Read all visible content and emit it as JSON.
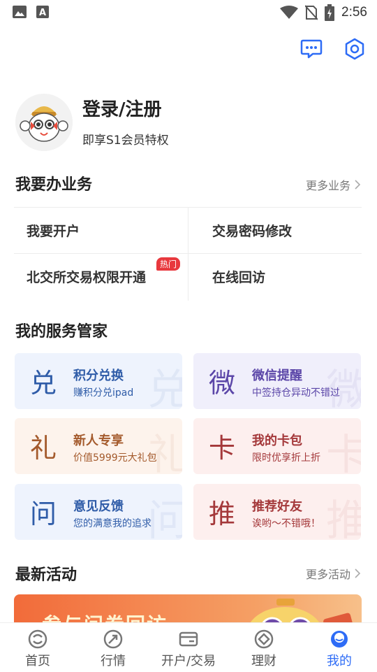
{
  "status_bar": {
    "time": "2:56"
  },
  "profile": {
    "login_label": "登录/注册",
    "subtitle": "即享S1会员特权"
  },
  "business": {
    "title": "我要办业务",
    "more_label": "更多业务",
    "items": [
      {
        "label": "我要开户"
      },
      {
        "label": "交易密码修改"
      },
      {
        "label": "北交所交易权限开通",
        "badge": "热门"
      },
      {
        "label": "在线回访"
      }
    ]
  },
  "service": {
    "title": "我的服务管家",
    "cards": [
      {
        "char": "兑",
        "title": "积分兑换",
        "subtitle": "赚积分兑ipad",
        "bg": "#eef3fd",
        "color": "#2f5ca8"
      },
      {
        "char": "微",
        "title": "微信提醒",
        "subtitle": "中签持仓异动不错过",
        "bg": "#f0effb",
        "color": "#5b46a8"
      },
      {
        "char": "礼",
        "title": "新人专享",
        "subtitle": "价值5999元大礼包",
        "bg": "#fdf3ec",
        "color": "#a45a2c"
      },
      {
        "char": "卡",
        "title": "我的卡包",
        "subtitle": "限时优享折上折",
        "bg": "#fdefee",
        "color": "#a4383a"
      },
      {
        "char": "问",
        "title": "意见反馈",
        "subtitle": "您的满意我的追求",
        "bg": "#eef3fd",
        "color": "#2f5ca8"
      },
      {
        "char": "推",
        "title": "推荐好友",
        "subtitle": "诶哟～不错哦！",
        "bg": "#fdefee",
        "color": "#a4383a"
      }
    ]
  },
  "activity": {
    "title": "最新活动",
    "more_label": "更多活动",
    "banner_text": "参与问卷回访"
  },
  "tabbar": {
    "items": [
      {
        "label": "首页",
        "icon": "home-icon"
      },
      {
        "label": "行情",
        "icon": "market-icon"
      },
      {
        "label": "开户/交易",
        "icon": "trade-icon"
      },
      {
        "label": "理财",
        "icon": "finance-icon"
      },
      {
        "label": "我的",
        "icon": "profile-icon",
        "active": true
      }
    ]
  },
  "colors": {
    "accent": "#2e6cf6",
    "hot_badge": "#e8383d"
  }
}
